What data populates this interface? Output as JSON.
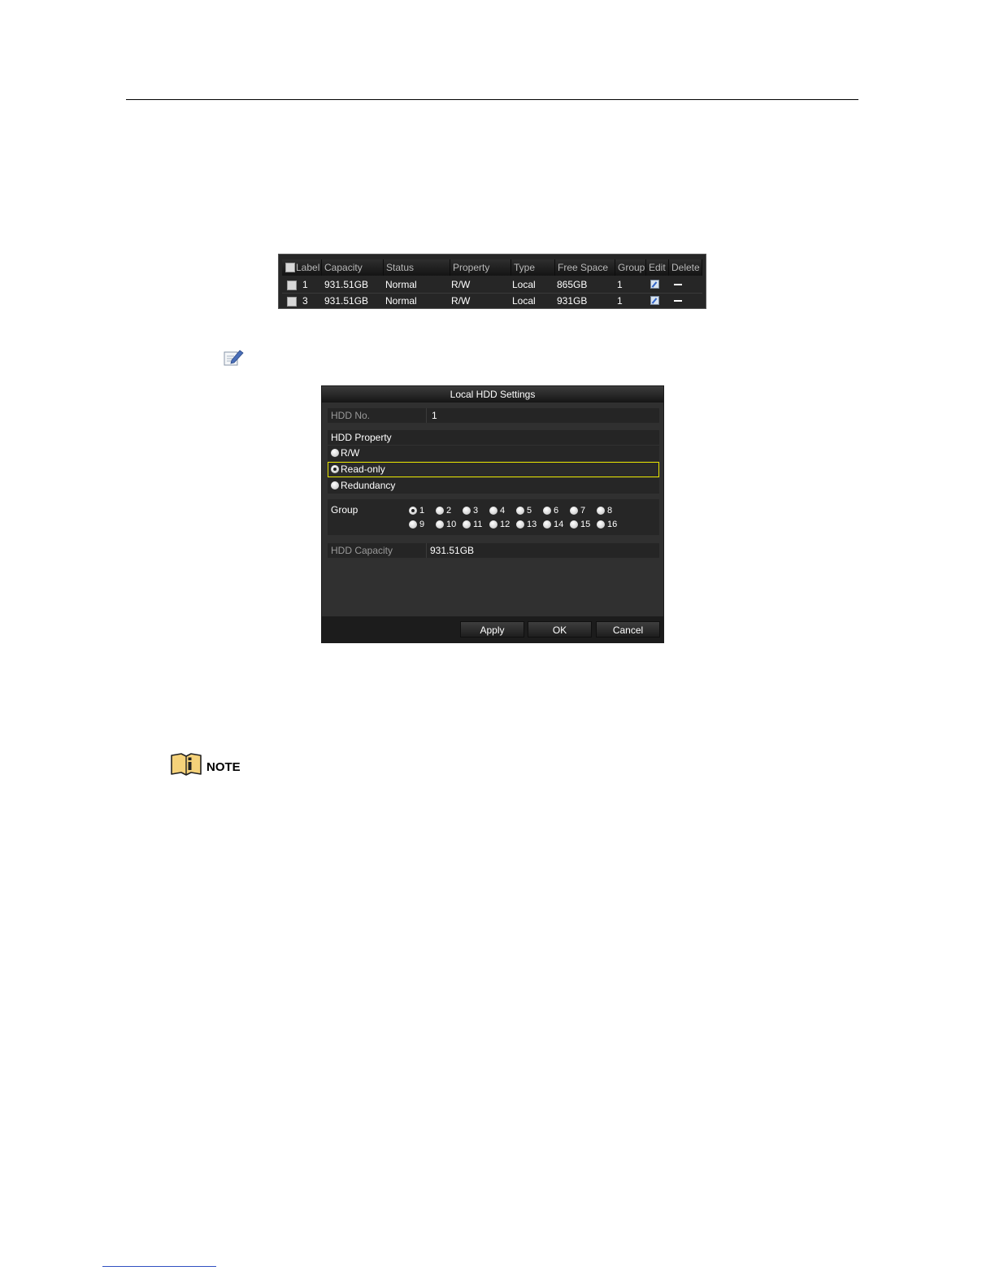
{
  "hdd_table": {
    "columns": [
      "Label",
      "Capacity",
      "Status",
      "Property",
      "Type",
      "Free Space",
      "Group",
      "Edit",
      "Delete"
    ],
    "rows": [
      {
        "label": "1",
        "capacity": "931.51GB",
        "status": "Normal",
        "property": "R/W",
        "type": "Local",
        "free_space": "865GB",
        "group": "1"
      },
      {
        "label": "3",
        "capacity": "931.51GB",
        "status": "Normal",
        "property": "R/W",
        "type": "Local",
        "free_space": "931GB",
        "group": "1"
      }
    ]
  },
  "dialog": {
    "title": "Local HDD Settings",
    "hdd_no_label": "HDD No.",
    "hdd_no_value": "1",
    "hdd_property_label": "HDD Property",
    "property_options": [
      "R/W",
      "Read-only",
      "Redundancy"
    ],
    "selected_property": "Read-only",
    "group_label": "Group",
    "group_options": [
      "1",
      "2",
      "3",
      "4",
      "5",
      "6",
      "7",
      "8",
      "9",
      "10",
      "11",
      "12",
      "13",
      "14",
      "15",
      "16"
    ],
    "selected_group": "1",
    "hdd_capacity_label": "HDD Capacity",
    "hdd_capacity_value": "931.51GB",
    "buttons": {
      "apply": "Apply",
      "ok": "OK",
      "cancel": "Cancel"
    }
  },
  "note": {
    "label": "NOTE"
  },
  "icons": {
    "edit": "edit-icon",
    "delete": "delete-icon",
    "note": "note-book-icon"
  }
}
